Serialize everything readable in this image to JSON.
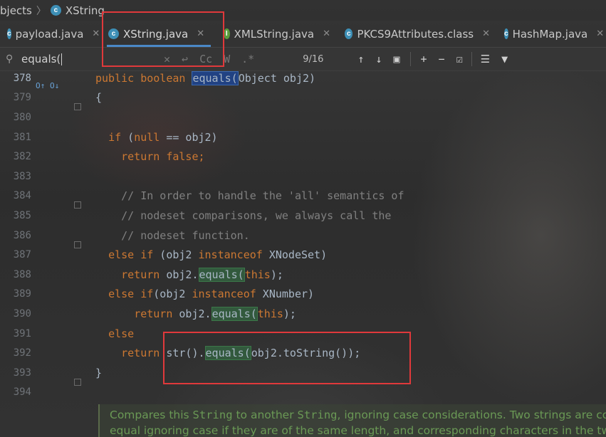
{
  "breadcrumb": {
    "left": "bjects",
    "right": "XString"
  },
  "tabs": [
    {
      "label": "payload.java",
      "icon": "class-icon"
    },
    {
      "label": "XString.java",
      "icon": "class-icon",
      "active": true
    },
    {
      "label": "XMLString.java",
      "icon": "interface-icon"
    },
    {
      "label": "PKCS9Attributes.class",
      "icon": "class-icon"
    },
    {
      "label": "HashMap.java",
      "icon": "class-icon"
    }
  ],
  "search": {
    "value": "equals(",
    "match_count": "9/16",
    "cc": "Cc",
    "w": "W",
    "regex": ".*"
  },
  "code_lines": [
    {
      "num": "378",
      "segs": [
        [
          "kw",
          "public boolean "
        ],
        [
          "hls",
          "equals("
        ],
        [
          "",
          "Object obj2)"
        ]
      ]
    },
    {
      "num": "379",
      "segs": [
        [
          "",
          "{"
        ]
      ]
    },
    {
      "num": "380",
      "segs": []
    },
    {
      "num": "381",
      "segs": [
        [
          "",
          "  "
        ],
        [
          "kw",
          "if"
        ],
        [
          "",
          " ("
        ],
        [
          "kw",
          "null"
        ],
        [
          "",
          " == obj2)"
        ]
      ]
    },
    {
      "num": "382",
      "segs": [
        [
          "",
          "    "
        ],
        [
          "kw",
          "return false;"
        ]
      ]
    },
    {
      "num": "383",
      "segs": []
    },
    {
      "num": "384",
      "segs": [
        [
          "",
          "    "
        ],
        [
          "cm",
          "// In order to handle the 'all' semantics of"
        ]
      ]
    },
    {
      "num": "385",
      "segs": [
        [
          "",
          "    "
        ],
        [
          "cm",
          "// nodeset comparisons, we always call the"
        ]
      ]
    },
    {
      "num": "386",
      "segs": [
        [
          "",
          "    "
        ],
        [
          "cm",
          "// nodeset function."
        ]
      ]
    },
    {
      "num": "387",
      "segs": [
        [
          "",
          "  "
        ],
        [
          "kw",
          "else if"
        ],
        [
          "",
          " (obj2 "
        ],
        [
          "kw",
          "instanceof"
        ],
        [
          "",
          " XNodeSet)"
        ]
      ]
    },
    {
      "num": "388",
      "segs": [
        [
          "",
          "    "
        ],
        [
          "kw",
          "return"
        ],
        [
          "",
          " obj2."
        ],
        [
          "hl",
          "equals("
        ],
        [
          "kw",
          "this"
        ],
        [
          "",
          ");"
        ]
      ]
    },
    {
      "num": "389",
      "segs": [
        [
          "",
          "  "
        ],
        [
          "kw",
          "else if"
        ],
        [
          "",
          "(obj2 "
        ],
        [
          "kw",
          "instanceof"
        ],
        [
          "",
          " XNumber)"
        ]
      ]
    },
    {
      "num": "390",
      "segs": [
        [
          "",
          "      "
        ],
        [
          "kw",
          "return"
        ],
        [
          "",
          " obj2."
        ],
        [
          "hl",
          "equals("
        ],
        [
          "kw",
          "this"
        ],
        [
          "",
          ");"
        ]
      ]
    },
    {
      "num": "391",
      "segs": [
        [
          "",
          "  "
        ],
        [
          "kw",
          "else"
        ]
      ]
    },
    {
      "num": "392",
      "segs": [
        [
          "",
          "    "
        ],
        [
          "kw",
          "return"
        ],
        [
          "",
          " str()."
        ],
        [
          "hl",
          "equals("
        ],
        [
          "",
          "obj2.toString());"
        ]
      ]
    },
    {
      "num": "393",
      "segs": [
        [
          "",
          "}"
        ]
      ]
    },
    {
      "num": "394",
      "segs": []
    }
  ],
  "doc": {
    "line1_a": "Compares this ",
    "line1_b": "String",
    "line1_c": " to another ",
    "line1_d": "String",
    "line1_e": ", ignoring case considerations. Two strings are co",
    "line2": "equal ignoring case if they are of the same length, and corresponding characters in the two"
  },
  "colors": {
    "keyword": "#cc7832",
    "comment": "#808080",
    "doc": "#6a9955",
    "highlight": "#e0393b"
  }
}
